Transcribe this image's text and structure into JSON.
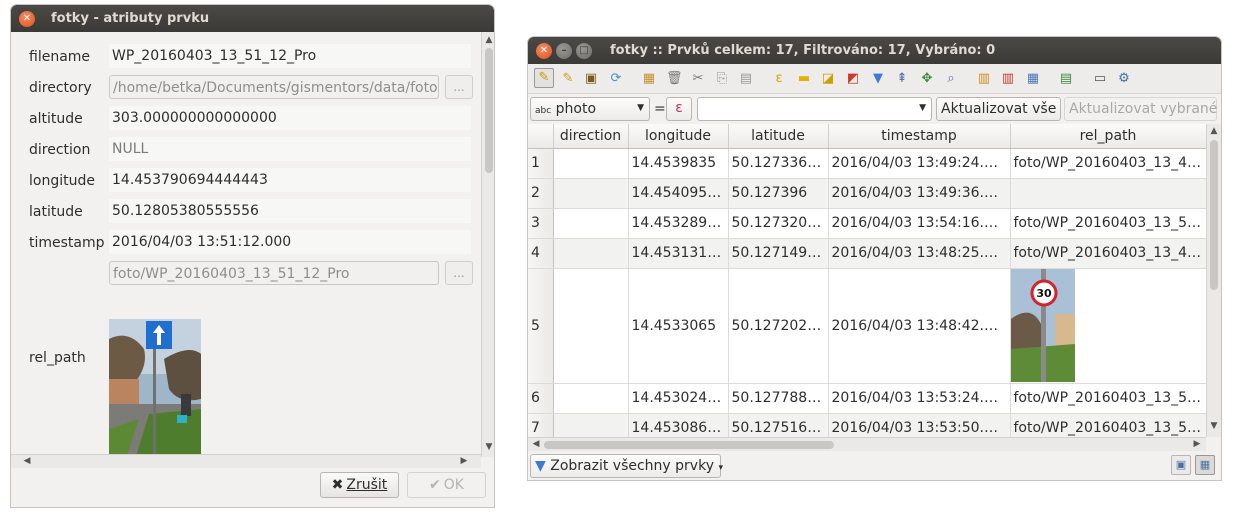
{
  "dialog": {
    "title": "fotky - atributy prvku",
    "fields": [
      {
        "label": "filename",
        "value": "WP_20160403_13_51_12_Pro"
      },
      {
        "label": "directory",
        "value": "/home/betka/Documents/gismentors/data/foto"
      },
      {
        "label": "altitude",
        "value": "303.000000000000000"
      },
      {
        "label": "direction",
        "value": "NULL"
      },
      {
        "label": "longitude",
        "value": "14.453790694444443"
      },
      {
        "label": "latitude",
        "value": "50.12805380555556"
      },
      {
        "label": "timestamp",
        "value": "2016/04/03 13:51:12.000"
      },
      {
        "label": "",
        "value": "foto/WP_20160403_13_51_12_Pro"
      }
    ],
    "rel_path_label": "rel_path",
    "browse_label": "...",
    "cancel_label": "Zrušit",
    "ok_label": "OK"
  },
  "table_window": {
    "title": "fotky :: Prvků celkem: 17, Filtrováno: 17, Vybráno: 0",
    "field_combo": "photo",
    "field_combo_prefix": "abc",
    "eq_label": "=",
    "expr_label": "ε",
    "expr_value": "",
    "update_all_label": "Aktualizovat vše",
    "update_selected_label": "Aktualizovat vybrané",
    "show_all_label": "Zobrazit všechny prvky",
    "columns": [
      "direction",
      "longitude",
      "latitude",
      "timestamp",
      "rel_path"
    ],
    "rows": [
      {
        "id": "1",
        "direction": "",
        "longitude": "14.4539835",
        "latitude": "50.127336…",
        "timestamp": "2016/04/03 13:49:24.000",
        "rel_path": "foto/WP_20160403_13_4…"
      },
      {
        "id": "2",
        "direction": "",
        "longitude": "14.454095…",
        "latitude": "50.127396",
        "timestamp": "2016/04/03 13:49:36.000",
        "rel_path": ""
      },
      {
        "id": "3",
        "direction": "",
        "longitude": "14.453289…",
        "latitude": "50.127320…",
        "timestamp": "2016/04/03 13:54:16.000",
        "rel_path": "foto/WP_20160403_13_5…"
      },
      {
        "id": "4",
        "direction": "",
        "longitude": "14.453131…",
        "latitude": "50.127149…",
        "timestamp": "2016/04/03 13:48:25.000",
        "rel_path": "foto/WP_20160403_13_4…"
      },
      {
        "id": "5",
        "direction": "",
        "longitude": "14.4533065",
        "latitude": "50.127202…",
        "timestamp": "2016/04/03 13:48:42.000",
        "rel_path": ""
      },
      {
        "id": "6",
        "direction": "",
        "longitude": "14.453024…",
        "latitude": "50.127788…",
        "timestamp": "2016/04/03 13:53:24.000",
        "rel_path": "foto/WP_20160403_13_5…"
      },
      {
        "id": "7",
        "direction": "",
        "longitude": "14.453086…",
        "latitude": "50.127516…",
        "timestamp": "2016/04/03 13:53:50.000",
        "rel_path": "foto/WP_20160403_13_5…"
      }
    ],
    "speed_sign": "30"
  }
}
